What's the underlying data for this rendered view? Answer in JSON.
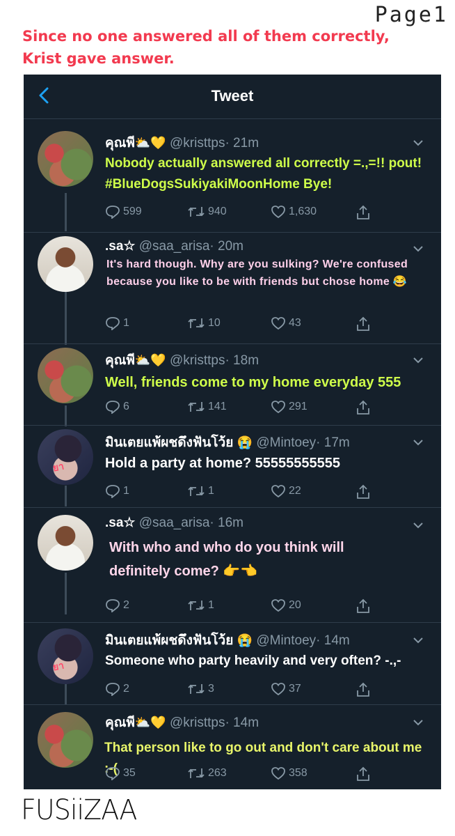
{
  "page_label": "Page1",
  "headline": "Since no one answered all of them correctly, Krist gave answer.",
  "signature": "FUSiiZAA",
  "app": {
    "title": "Tweet",
    "back_icon": "chevron-left-icon"
  },
  "colors": {
    "background": "#15202b",
    "headline": "#f23a4f",
    "accent": "#1da1f2",
    "muted": "#8899a6"
  },
  "tweets": [
    {
      "name": "คุณพี",
      "name_emoji": "⛅💛",
      "handle": "@kristtps",
      "time": "· 21m",
      "text": "Nobody actually answered all correctly =.,=!! pout! #BlueDogsSukiyakiMoonHome Bye!",
      "replies": "599",
      "retweets": "940",
      "likes": "1,630"
    },
    {
      "name": ".sa☆",
      "name_emoji": "",
      "handle": "@saa_arisa",
      "time": "· 20m",
      "text": "It's hard though. Why are you sulking? We're confused because you like to be with friends but chose home 😂",
      "replies": "1",
      "retweets": "10",
      "likes": "43"
    },
    {
      "name": "คุณพี",
      "name_emoji": "⛅💛",
      "handle": "@kristtps",
      "time": "· 18m",
      "text": "Well, friends come to my home everyday 555",
      "replies": "6",
      "retweets": "141",
      "likes": "291"
    },
    {
      "name": "มินเตยแพ้ผชดึงฟันโว้ย",
      "name_emoji": "😭",
      "handle": "@Mintoey",
      "time": "· 17m",
      "text": "Hold a party at home? 55555555555",
      "replies": "1",
      "retweets": "1",
      "likes": "22"
    },
    {
      "name": ".sa☆",
      "name_emoji": "",
      "handle": "@saa_arisa",
      "time": "· 16m",
      "text": "With who and who do you think will definitely come? 👉👈",
      "replies": "2",
      "retweets": "1",
      "likes": "20"
    },
    {
      "name": "มินเตยแพ้ผชดึงฟันโว้ย",
      "name_emoji": "😭",
      "handle": "@Mintoey",
      "time": "· 14m",
      "text": "Someone who party heavily and very often? -.,-",
      "replies": "2",
      "retweets": "3",
      "likes": "37"
    },
    {
      "name": "คุณพี",
      "name_emoji": "⛅💛",
      "handle": "@kristtps",
      "time": "· 14m",
      "text": "That person like to go out and don't care about me :-(",
      "replies": "35",
      "retweets": "263",
      "likes": "358"
    }
  ],
  "avatar_marks": {
    "mintoey": "ยา"
  }
}
